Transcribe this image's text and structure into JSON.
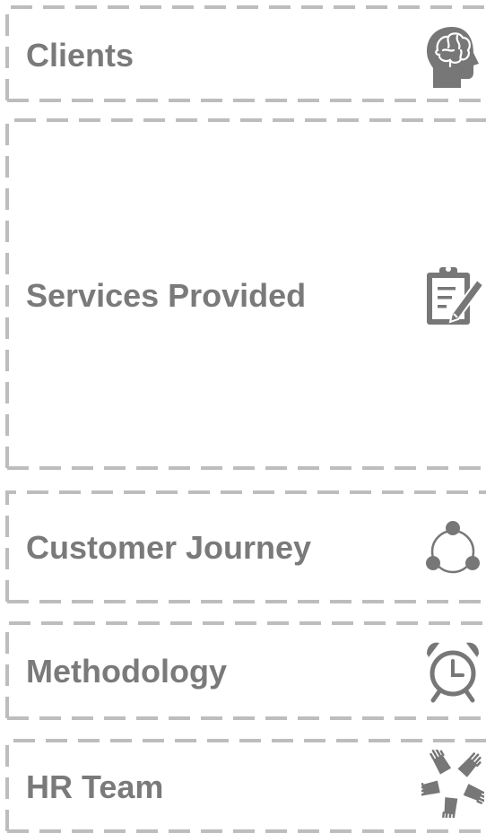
{
  "colors": {
    "text": "#7a7a7a",
    "icon": "#777777",
    "border": "#bdbdbd"
  },
  "sections": [
    {
      "label": "Clients",
      "icon": "brain-head-icon"
    },
    {
      "label": "Services Provided",
      "icon": "clipboard-pen-icon"
    },
    {
      "label": "Customer Journey",
      "icon": "cycle-nodes-icon"
    },
    {
      "label": "Methodology",
      "icon": "alarm-clock-icon"
    },
    {
      "label": "HR Team",
      "icon": "hands-circle-icon"
    }
  ]
}
